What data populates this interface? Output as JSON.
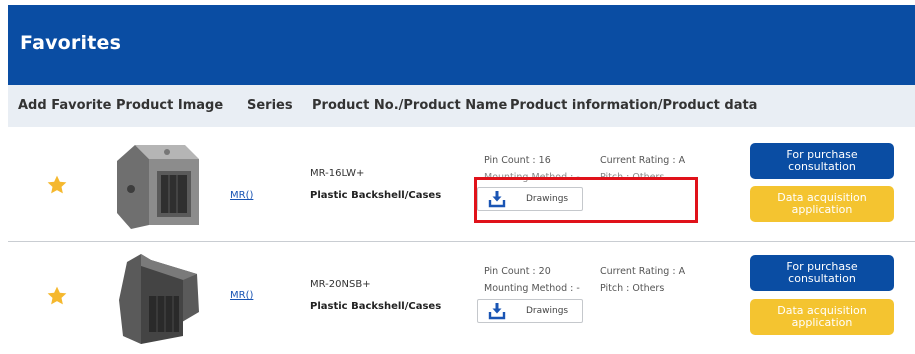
{
  "header": {
    "title": "Favorites"
  },
  "columns": {
    "add_favorite": "Add Favorite",
    "product_image": "Product Image",
    "series": "Series",
    "product_no": "Product No./Product Name",
    "product_info": "Product information/Product data"
  },
  "products": [
    {
      "series": "MR()",
      "product_no": "MR-16LW+",
      "product_name": "Plastic Backshell/Cases",
      "pin_count": "Pin Count : 16",
      "current_rating": "Current Rating : A",
      "mounting_method": "Mounting Method : -",
      "pitch": "Pitch : Others",
      "drawings_label": "Drawings",
      "purchase_line1": "For purchase",
      "purchase_line2": "consultation",
      "data_line1": "Data acquisition",
      "data_line2": "application"
    },
    {
      "series": "MR()",
      "product_no": "MR-20NSB+",
      "product_name": "Plastic Backshell/Cases",
      "pin_count": "Pin Count : 20",
      "current_rating": "Current Rating : A",
      "mounting_method": "Mounting Method : -",
      "pitch": "Pitch : Others",
      "drawings_label": "Drawings",
      "purchase_line1": "For purchase",
      "purchase_line2": "consultation",
      "data_line1": "Data acquisition",
      "data_line2": "application"
    }
  ],
  "colors": {
    "brand_blue": "#0a4da3",
    "accent_yellow": "#f4c430",
    "star": "#f5b82e",
    "highlight": "#e0121a"
  },
  "icons": {
    "favorite": "star-icon",
    "download": "download-icon"
  }
}
